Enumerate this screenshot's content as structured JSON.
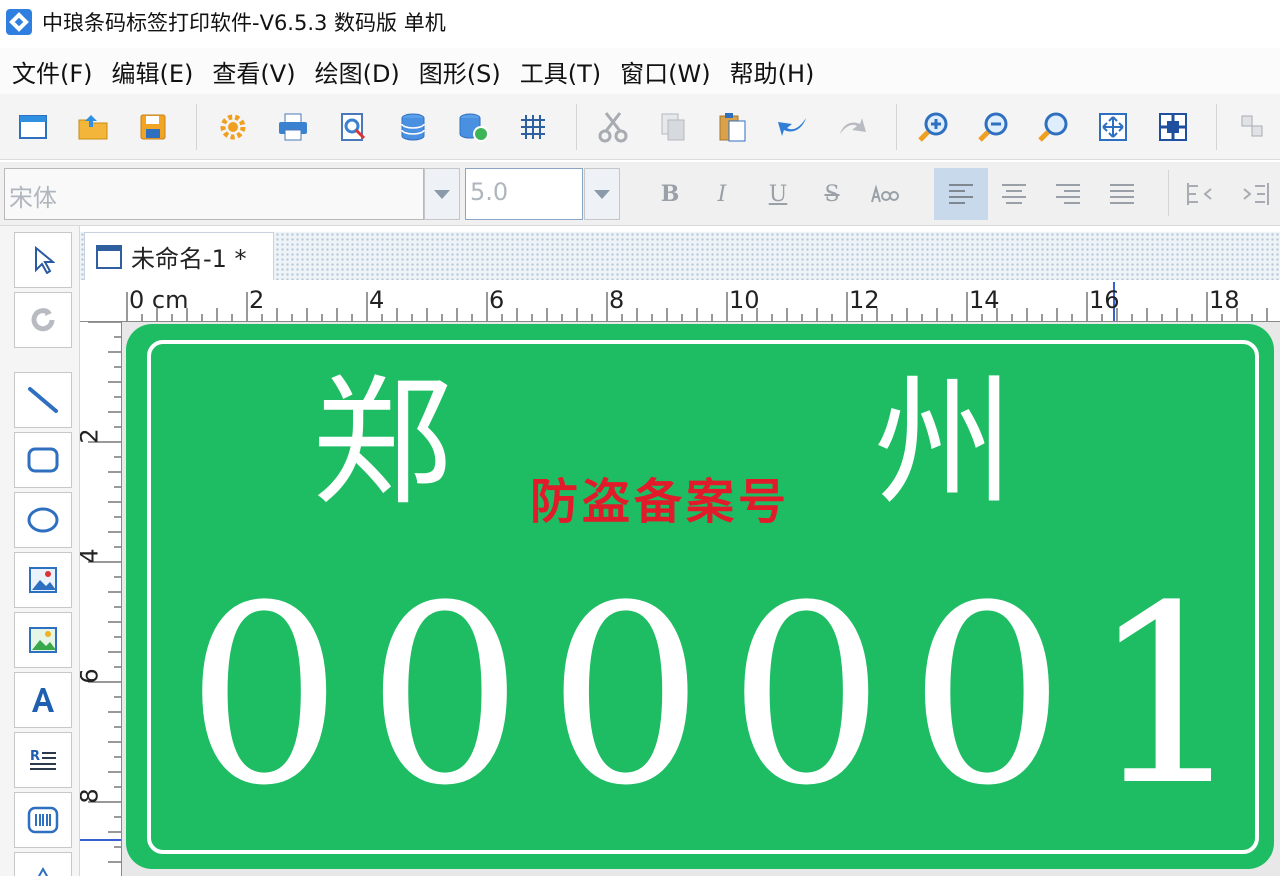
{
  "window": {
    "title": "中琅条码标签打印软件-V6.5.3 数码版 单机"
  },
  "menu": {
    "items": [
      {
        "label": "文件(F)"
      },
      {
        "label": "编辑(E)"
      },
      {
        "label": "查看(V)"
      },
      {
        "label": "绘图(D)"
      },
      {
        "label": "图形(S)"
      },
      {
        "label": "工具(T)"
      },
      {
        "label": "窗口(W)"
      },
      {
        "label": "帮助(H)"
      }
    ]
  },
  "toolbar": {
    "icons": [
      "new-icon",
      "open-icon",
      "save-icon",
      "settings-icon",
      "print-icon",
      "print-preview-icon",
      "database-icon",
      "database-settings-icon",
      "grid-icon",
      "cut-icon",
      "copy-icon",
      "paste-icon",
      "undo-icon",
      "redo-icon",
      "zoom-in-icon",
      "zoom-out-icon",
      "zoom-icon",
      "fit-page-icon",
      "actual-size-icon",
      "arrange-icon"
    ]
  },
  "format": {
    "font_name": "宋体",
    "font_size": "5.0",
    "bold_glyph": "B",
    "italic_glyph": "I",
    "underline_glyph": "U",
    "strike_glyph": "S",
    "active_alignment": "left"
  },
  "document": {
    "tab_label": "未命名-1 *"
  },
  "ruler": {
    "horizontal": [
      "0 cm",
      "2",
      "4",
      "6",
      "8",
      "10",
      "12",
      "14",
      "16",
      "18"
    ],
    "vertical": [
      "2",
      "4",
      "6",
      "8"
    ]
  },
  "label": {
    "plate_color": "#1ebd64",
    "subtitle_color": "#e11b2a",
    "city_first": "郑",
    "city_second": "州",
    "subtitle": "防盗备案号",
    "serial": [
      "0",
      "0",
      "0",
      "0",
      "0",
      "1"
    ]
  }
}
